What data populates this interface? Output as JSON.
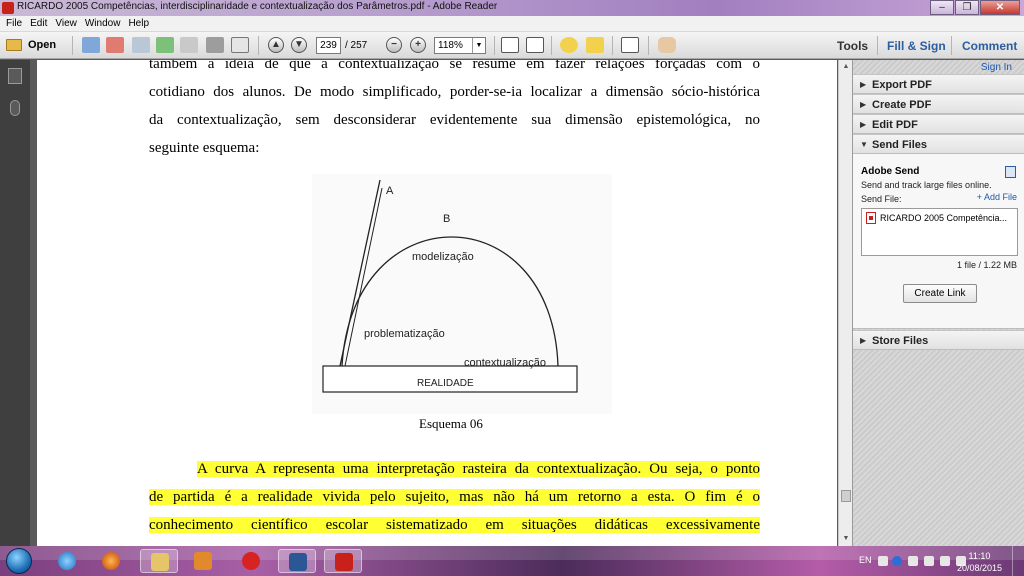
{
  "window": {
    "title": "RICARDO 2005 Competências, interdisciplinaridade e contextualização dos Parâmetros.pdf - Adobe Reader",
    "minimize": "–",
    "maximize": "❐",
    "close": "✕"
  },
  "menu": [
    "File",
    "Edit",
    "View",
    "Window",
    "Help"
  ],
  "toolbar": {
    "open_label": "Open",
    "page_current": "239",
    "page_total": "/ 257",
    "zoom": "118%",
    "tools_label": "Tools",
    "fillsign_label": "Fill & Sign",
    "comment_label": "Comment"
  },
  "document": {
    "para1_lines": [
      "também a ideia de que a contextualização se resume em fazer relações forçadas com o",
      "cotidiano dos alunos. De modo simplificado, porder-se-ia localizar a dimensão sócio-histórica",
      "da contextualização, sem desconsiderar evidentemente sua dimensão epistemológica, no",
      "seguinte esquema:"
    ],
    "diagram": {
      "label_a": "A",
      "label_b": "B",
      "modelizacao": "modelização",
      "problematizacao": "problematização",
      "contextualizacao": "contextualização",
      "realidade": "REALIDADE"
    },
    "caption": "Esquema 06",
    "para2_lines": [
      "A curva A representa uma interpretação rasteira da contextualização. Ou seja, o ponto",
      "de partida é a realidade vivida pelo sujeito, mas não há um retorno a esta. O fim é o",
      "conhecimento científico escolar sistematizado em situações didáticas excessivamente"
    ]
  },
  "right_pane": {
    "sign_in": "Sign In",
    "sections": {
      "export_pdf": "Export PDF",
      "create_pdf": "Create PDF",
      "edit_pdf": "Edit PDF",
      "send_files": "Send Files",
      "store_files": "Store Files"
    },
    "adobe_send": {
      "heading": "Adobe Send",
      "description": "Send and track large files online.",
      "send_file_label": "Send File:",
      "add_file": "+ Add File",
      "file_name": "RICARDO 2005 Competência...",
      "file_count": "1 file / 1.22 MB",
      "create_link": "Create Link"
    }
  },
  "taskbar": {
    "language": "EN",
    "time": "11:10",
    "date": "20/08/2015",
    "apps": [
      "internet-explorer",
      "firefox",
      "file-explorer",
      "media-player",
      "claro",
      "word",
      "adobe-reader"
    ]
  },
  "colors": {
    "highlight": "#ffff33",
    "accent_link": "#1c58b0",
    "reader_red": "#c8201a"
  }
}
